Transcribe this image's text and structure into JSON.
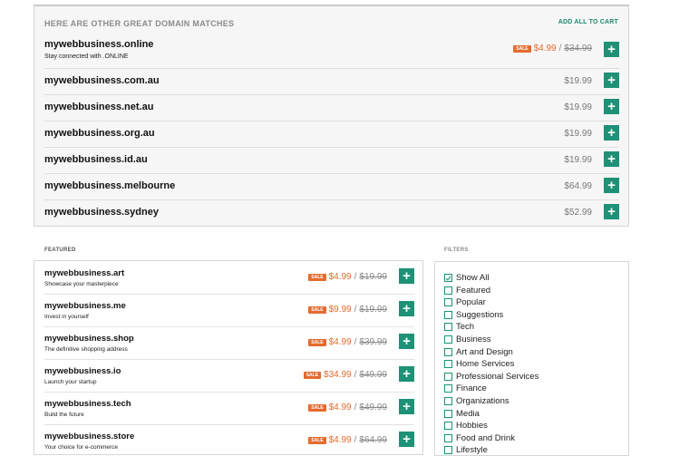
{
  "top_panel": {
    "header": "HERE ARE OTHER GREAT DOMAIN MATCHES",
    "add_all": "ADD ALL TO CART",
    "rows": [
      {
        "name": "mywebbusiness.online",
        "desc": "Stay connected with .ONLINE",
        "sale": "SALE",
        "price": "$4.99",
        "sep": "/",
        "old": "$34.99"
      },
      {
        "name": "mywebbusiness.com.au",
        "price": "$19.99"
      },
      {
        "name": "mywebbusiness.net.au",
        "price": "$19.99"
      },
      {
        "name": "mywebbusiness.org.au",
        "price": "$19.99"
      },
      {
        "name": "mywebbusiness.id.au",
        "price": "$19.99"
      },
      {
        "name": "mywebbusiness.melbourne",
        "price": "$64.99"
      },
      {
        "name": "mywebbusiness.sydney",
        "price": "$52.99"
      }
    ]
  },
  "featured": {
    "label": "FEATURED",
    "rows": [
      {
        "name": "mywebbusiness.art",
        "desc": "Showcase your masterpiece",
        "sale": "SALE",
        "price": "$4.99",
        "sep": "/",
        "old": "$19.99"
      },
      {
        "name": "mywebbusiness.me",
        "desc": "Invest in yourself",
        "sale": "SALE",
        "price": "$9.99",
        "sep": "/",
        "old": "$19.99"
      },
      {
        "name": "mywebbusiness.shop",
        "desc": "The definitive shopping address",
        "sale": "SALE",
        "price": "$4.99",
        "sep": "/",
        "old": "$39.99"
      },
      {
        "name": "mywebbusiness.io",
        "desc": "Launch your startup",
        "sale": "SALE",
        "price": "$34.99",
        "sep": "/",
        "old": "$49.99"
      },
      {
        "name": "mywebbusiness.tech",
        "desc": "Build the future",
        "sale": "SALE",
        "price": "$4.99",
        "sep": "/",
        "old": "$49.99"
      },
      {
        "name": "mywebbusiness.store",
        "desc": "Your choice for e-commerce",
        "sale": "SALE",
        "price": "$4.99",
        "sep": "/",
        "old": "$64.99"
      }
    ]
  },
  "filters": {
    "label": "FILTERS",
    "items": [
      {
        "label": "Show All",
        "checked": true
      },
      {
        "label": "Featured",
        "checked": false
      },
      {
        "label": "Popular",
        "checked": false
      },
      {
        "label": "Suggestions",
        "checked": false
      },
      {
        "label": "Tech",
        "checked": false
      },
      {
        "label": "Business",
        "checked": false
      },
      {
        "label": "Art and Design",
        "checked": false
      },
      {
        "label": "Home Services",
        "checked": false
      },
      {
        "label": "Professional Services",
        "checked": false
      },
      {
        "label": "Finance",
        "checked": false
      },
      {
        "label": "Organizations",
        "checked": false
      },
      {
        "label": "Media",
        "checked": false
      },
      {
        "label": "Hobbies",
        "checked": false
      },
      {
        "label": "Food and Drink",
        "checked": false
      },
      {
        "label": "Lifestyle",
        "checked": false
      }
    ]
  },
  "add_icon": "plus-icon",
  "colors": {
    "accent": "#1e9176",
    "sale": "#e46b2f",
    "muted": "#8a8a8a"
  }
}
